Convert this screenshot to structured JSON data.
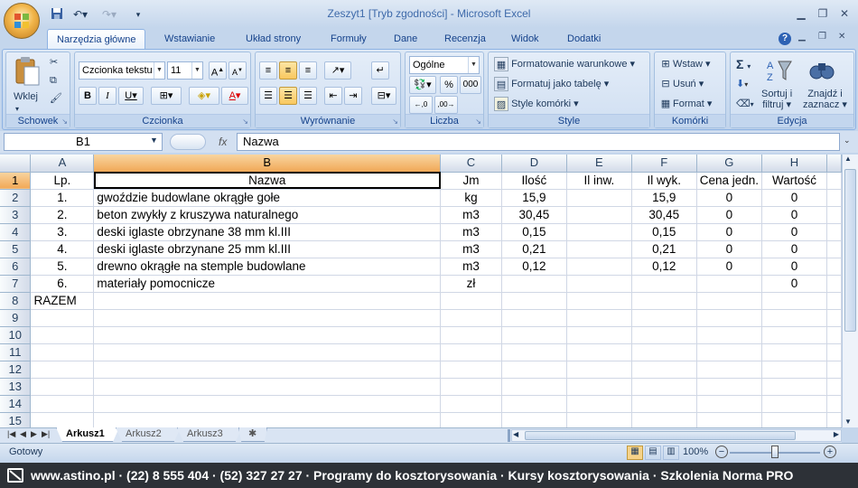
{
  "window": {
    "title": "Zeszyt1  [Tryb zgodności] - Microsoft Excel"
  },
  "tabs": [
    "Narzędzia główne",
    "Wstawianie",
    "Układ strony",
    "Formuły",
    "Dane",
    "Recenzja",
    "Widok",
    "Dodatki"
  ],
  "ribbon": {
    "clipboard": {
      "paste_label": "Wklej",
      "group": "Schowek"
    },
    "font": {
      "font_name": "Czcionka tekstu",
      "font_size": "11",
      "group": "Czcionka"
    },
    "alignment": {
      "group": "Wyrównanie"
    },
    "number": {
      "format": "Ogólne",
      "percent": "%",
      "thousands": "000",
      "group": "Liczba"
    },
    "styles": {
      "cond_format": "Formatowanie warunkowe",
      "format_table": "Formatuj jako tabelę",
      "cell_styles": "Style komórki",
      "group": "Style"
    },
    "cells": {
      "insert": "Wstaw",
      "delete": "Usuń",
      "format": "Format",
      "group": "Komórki"
    },
    "editing": {
      "sum": "Σ",
      "sort_l1": "Sortuj i",
      "sort_l2": "filtruj",
      "find_l1": "Znajdź i",
      "find_l2": "zaznacz",
      "group": "Edycja"
    }
  },
  "formula_bar": {
    "name_box": "B1",
    "fx": "fx",
    "content": "Nazwa"
  },
  "columns": [
    "A",
    "B",
    "C",
    "D",
    "E",
    "F",
    "G",
    "H"
  ],
  "rows": [
    [
      "Lp.",
      "Nazwa",
      "Jm",
      "Ilość",
      "Il inw.",
      "Il wyk.",
      "Cena jedn.",
      "Wartość"
    ],
    [
      "1.",
      "gwoździe budowlane okrągłe gołe",
      "kg",
      "15,9",
      "",
      "15,9",
      "0",
      "0"
    ],
    [
      "2.",
      "beton zwykły z kruszywa naturalnego",
      "m3",
      "30,45",
      "",
      "30,45",
      "0",
      "0"
    ],
    [
      "3.",
      "deski iglaste obrzynane 38 mm kl.III",
      "m3",
      "0,15",
      "",
      "0,15",
      "0",
      "0"
    ],
    [
      "4.",
      "deski iglaste obrzynane 25 mm kl.III",
      "m3",
      "0,21",
      "",
      "0,21",
      "0",
      "0"
    ],
    [
      "5.",
      "drewno okrągłe na stemple budowlane",
      "m3",
      "0,12",
      "",
      "0,12",
      "0",
      "0"
    ],
    [
      "6.",
      "materiały pomocnicze",
      "zł",
      "",
      "",
      "",
      "",
      "0"
    ],
    [
      "RAZEM",
      "",
      "",
      "",
      "",
      "",
      "",
      ""
    ],
    [
      "",
      "",
      "",
      "",
      "",
      "",
      "",
      ""
    ],
    [
      "",
      "",
      "",
      "",
      "",
      "",
      "",
      ""
    ],
    [
      "",
      "",
      "",
      "",
      "",
      "",
      "",
      ""
    ],
    [
      "",
      "",
      "",
      "",
      "",
      "",
      "",
      ""
    ],
    [
      "",
      "",
      "",
      "",
      "",
      "",
      "",
      ""
    ],
    [
      "",
      "",
      "",
      "",
      "",
      "",
      "",
      ""
    ],
    [
      "",
      "",
      "",
      "",
      "",
      "",
      "",
      ""
    ]
  ],
  "sheets": [
    "Arkusz1",
    "Arkusz2",
    "Arkusz3"
  ],
  "status": {
    "ready": "Gotowy",
    "zoom": "100%"
  },
  "footer": "www.astino.pl · (22) 8 555 404 · (52) 327 27 27 · Programy do kosztorysowania · Kursy kosztorysowania · Szkolenia Norma PRO"
}
